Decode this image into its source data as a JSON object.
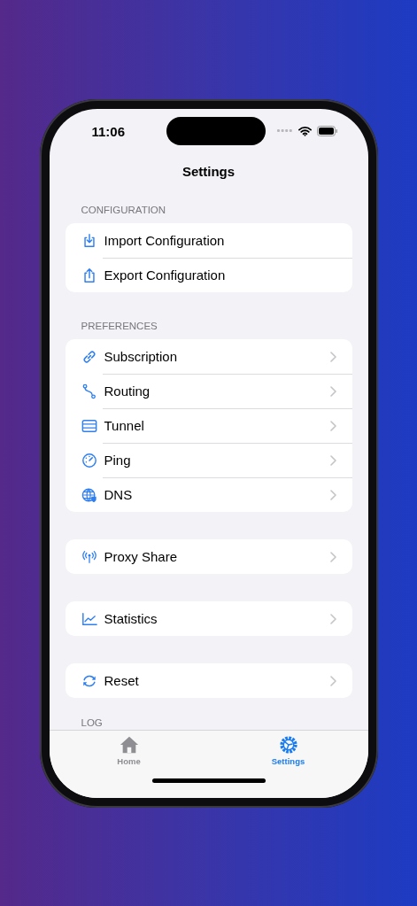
{
  "status_bar": {
    "time": "11:06"
  },
  "nav": {
    "title": "Settings"
  },
  "sections": [
    {
      "header": "CONFIGURATION",
      "rows": [
        {
          "label": "Import Configuration",
          "kind": "import",
          "chevron": false
        },
        {
          "label": "Export Configuration",
          "kind": "export",
          "chevron": false
        }
      ]
    },
    {
      "header": "PREFERENCES",
      "rows": [
        {
          "label": "Subscription",
          "kind": "link",
          "chevron": true
        },
        {
          "label": "Routing",
          "kind": "route",
          "chevron": true
        },
        {
          "label": "Tunnel",
          "kind": "server",
          "chevron": true
        },
        {
          "label": "Ping",
          "kind": "gauge",
          "chevron": true
        },
        {
          "label": "DNS",
          "kind": "globe",
          "chevron": true
        }
      ]
    },
    {
      "rows": [
        {
          "label": "Proxy Share",
          "kind": "antenna",
          "chevron": true
        }
      ]
    },
    {
      "rows": [
        {
          "label": "Statistics",
          "kind": "chart",
          "chevron": true
        }
      ]
    },
    {
      "rows": [
        {
          "label": "Reset",
          "kind": "sync",
          "chevron": true
        }
      ]
    },
    {
      "header": "LOG"
    }
  ],
  "tabs": [
    {
      "label": "Home",
      "kind": "home",
      "selected": false
    },
    {
      "label": "Settings",
      "kind": "gear",
      "selected": true
    }
  ]
}
